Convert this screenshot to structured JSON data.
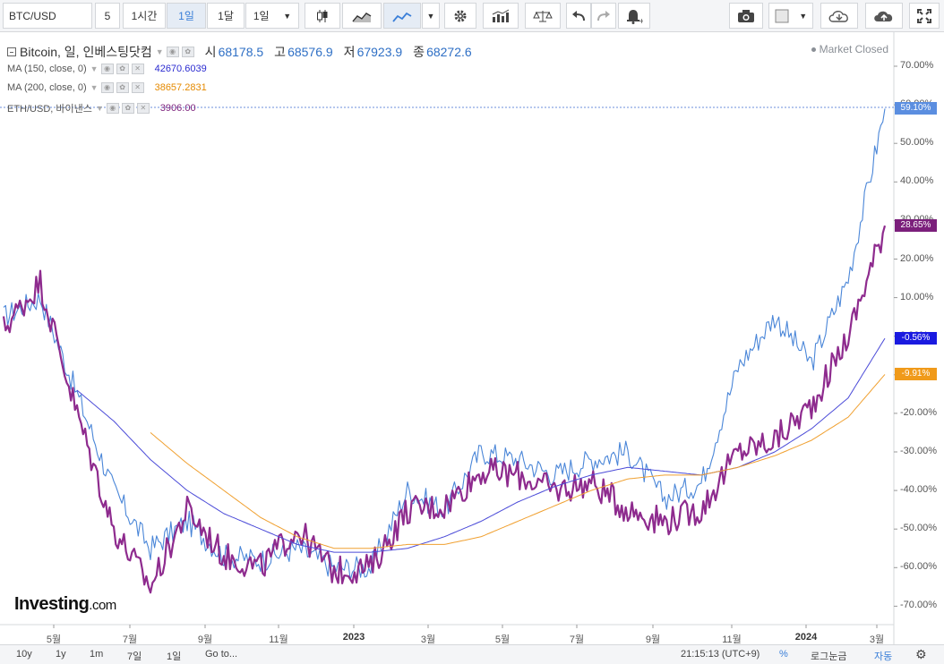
{
  "toolbar": {
    "symbol": "BTC/USD",
    "multiplier": "5",
    "interval_1h": "1시간",
    "interval_1d": "1일",
    "interval_1mo": "1달",
    "interval_dropdown": "1일",
    "icons": [
      "candles-icon",
      "area-chart-icon",
      "line-chart-icon",
      "settings-gear-icon",
      "indicators-icon",
      "compare-scale-icon",
      "undo-icon",
      "redo-icon",
      "alert-bell-icon",
      "camera-icon",
      "drawing-square-icon",
      "cloud-download-icon",
      "cloud-upload-icon",
      "fullscreen-icon"
    ]
  },
  "legend": {
    "title": "Bitcoin, 일, 인베스팅닷컴",
    "open_label": "시",
    "open": "68178.5",
    "high_label": "고",
    "high": "68576.9",
    "low_label": "저",
    "low": "67923.9",
    "close_label": "종",
    "close": "68272.6",
    "ma150_label": "MA (150, close, 0)",
    "ma150_value": "42670.6039",
    "ma200_label": "MA (200, close, 0)",
    "ma200_value": "38657.2831",
    "eth_label": "ETH/USD, 바이낸스",
    "eth_value": "3906.00",
    "market_status": "Market Closed"
  },
  "axis": {
    "y_ticks": [
      "70.00%",
      "60.00%",
      "50.00%",
      "40.00%",
      "30.00%",
      "20.00%",
      "10.00%",
      "0.00%",
      "-10.00%",
      "-20.00%",
      "-30.00%",
      "-40.00%",
      "-50.00%",
      "-60.00%",
      "-70.00%"
    ],
    "x_ticks": [
      "5월",
      "7월",
      "9월",
      "11월",
      "2023",
      "3월",
      "5월",
      "7월",
      "9월",
      "11월",
      "2024",
      "3월"
    ],
    "tags": {
      "btc": "59.10%",
      "eth": "28.65%",
      "ma150": "-0.56%",
      "ma200": "-9.91%"
    }
  },
  "colors": {
    "btc": "#4a86d8",
    "eth": "#8e2b8e",
    "ma150": "#4b4bd8",
    "ma200": "#f0a030",
    "btc_tag": "#5b8ee0",
    "eth_tag": "#7b1f7b",
    "ma150_tag": "#1a1ae0",
    "ma200_tag": "#f09a1a"
  },
  "chart_data": {
    "type": "line",
    "y_unit": "% change",
    "ylim": [
      -75,
      78
    ],
    "x": [
      "2022-03",
      "2022-04",
      "2022-05",
      "2022-06",
      "2022-07",
      "2022-08",
      "2022-09",
      "2022-10",
      "2022-11",
      "2022-12",
      "2023-01",
      "2023-02",
      "2023-03",
      "2023-04",
      "2023-05",
      "2023-06",
      "2023-07",
      "2023-08",
      "2023-09",
      "2023-10",
      "2023-11",
      "2023-12",
      "2024-01",
      "2024-02",
      "2024-03"
    ],
    "series": [
      {
        "name": "Bitcoin",
        "values": [
          5,
          10,
          -15,
          -40,
          -55,
          -48,
          -57,
          -58,
          -55,
          -60,
          -60,
          -40,
          -45,
          -30,
          -32,
          -36,
          -32,
          -30,
          -42,
          -38,
          -8,
          5,
          -7,
          15,
          59
        ]
      },
      {
        "name": "ETH/USD",
        "values": [
          2,
          14,
          -20,
          -50,
          -65,
          -45,
          -57,
          -60,
          -50,
          -61,
          -60,
          -45,
          -44,
          -35,
          -36,
          -40,
          -38,
          -45,
          -48,
          -45,
          -30,
          -27,
          -18,
          0,
          28.65
        ]
      },
      {
        "name": "MA (150, close, 0)",
        "values": [
          null,
          null,
          -14,
          -22,
          -32,
          -40,
          -46,
          -50,
          -54,
          -56,
          -56,
          -55,
          -52,
          -48,
          -43,
          -39,
          -36,
          -34,
          -35,
          -36,
          -34,
          -30,
          -24,
          -16,
          -0.56
        ]
      },
      {
        "name": "MA (200, close, 0)",
        "values": [
          null,
          null,
          null,
          null,
          -25,
          -33,
          -40,
          -47,
          -52,
          -55,
          -55,
          -54,
          -54,
          -52,
          -48,
          -44,
          -40,
          -37,
          -36,
          -36,
          -34,
          -31,
          -27,
          -21,
          -9.91
        ]
      }
    ]
  },
  "bottombar": {
    "ranges": [
      "10y",
      "1y",
      "1m",
      "7일",
      "1일",
      "Go to..."
    ],
    "time": "21:15:13 (UTC+9)",
    "percent": "%",
    "log": "로그눈금",
    "auto": "자동"
  }
}
